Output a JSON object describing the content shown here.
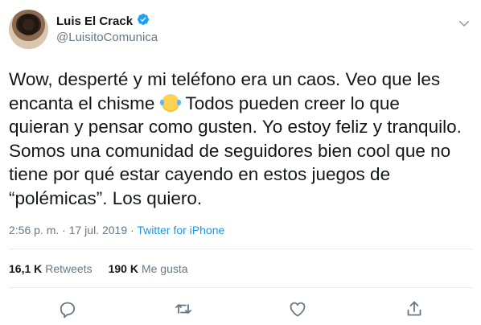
{
  "user": {
    "display_name": "Luis El Crack",
    "handle": "@LuisitoComunica"
  },
  "tweet": {
    "text_before_emoji": "Wow, desperté y mi teléfono era un caos. Veo que les\nencanta el chisme ",
    "emoji": "face-with-tears-of-joy",
    "text_after_emoji": " Todos pueden creer lo que\nquieran y pensar como gusten. Yo estoy feliz y tranquilo.\nSomos una comunidad de seguidores bien cool que no\ntiene por qué estar cayendo en estos juegos de\n“polémicas”. Los quiero."
  },
  "meta": {
    "time": "2:56 p. m.",
    "separator": " · ",
    "date": "17 jul. 2019",
    "source": "Twitter for iPhone"
  },
  "stats": {
    "retweets_count": "16,1 K",
    "retweets_label": "Retweets",
    "likes_count": "190 K",
    "likes_label": "Me gusta"
  },
  "colors": {
    "accent": "#1b95e0",
    "verified": "#1da1f2",
    "secondary_text": "#657786",
    "divider": "#e6ecf0"
  },
  "icons": [
    "verified-badge-icon",
    "chevron-down-icon",
    "reply-icon",
    "retweet-icon",
    "like-icon",
    "share-icon"
  ]
}
